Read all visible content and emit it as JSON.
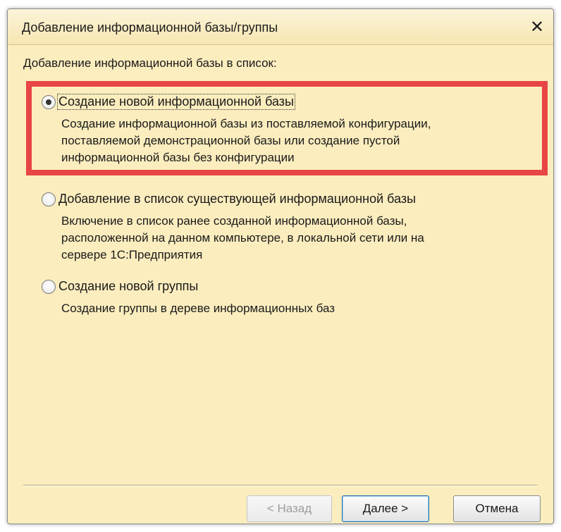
{
  "dialog": {
    "title": "Добавление информационной базы/группы",
    "close_glyph": "✕"
  },
  "content": {
    "heading": "Добавление информационной базы в список:",
    "options": [
      {
        "label": "Создание новой информационной базы",
        "selected": true,
        "description": [
          "Создание информационной базы из поставляемой конфигурации,",
          "поставляемой демонстрационной базы или создание пустой",
          "информационной базы без конфигурации"
        ]
      },
      {
        "label": "Добавление в список существующей информационной базы",
        "selected": false,
        "description": [
          "Включение в список ранее созданной информационной базы,",
          "расположенной на данном компьютере,  в локальной сети или на",
          "сервере 1С:Предприятия"
        ]
      },
      {
        "label": "Создание новой группы",
        "selected": false,
        "description": [
          "Создание группы в дереве информационных баз"
        ]
      }
    ]
  },
  "buttons": {
    "back": "< Назад",
    "next": "Далее >",
    "cancel": "Отмена"
  },
  "colors": {
    "dialog_background": "#fbedbe",
    "highlight": "#e84545"
  }
}
